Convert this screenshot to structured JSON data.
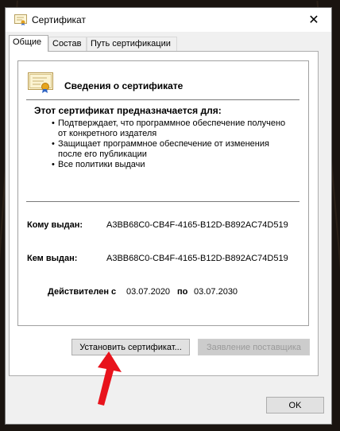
{
  "window": {
    "title": "Сертификат",
    "close_symbol": "✕"
  },
  "tabs": [
    {
      "label": "Общие"
    },
    {
      "label": "Состав"
    },
    {
      "label": "Путь сертификации"
    }
  ],
  "certificate": {
    "heading": "Сведения о сертификате",
    "purpose_title": "Этот сертификат предназначается для:",
    "purposes": [
      "Подтверждает, что программное обеспечение получено от конкретного издателя",
      "Защищает программное обеспечение от  изменения после его публикации",
      "Все политики выдачи"
    ],
    "issued_to_label": "Кому выдан:",
    "issued_to_value": "A3BB68C0-CB4F-4165-B12D-B892AC74D519",
    "issued_by_label": "Кем выдан:",
    "issued_by_value": "A3BB68C0-CB4F-4165-B12D-B892AC74D519",
    "valid_from_label": "Действителен с",
    "valid_from": "03.07.2020",
    "valid_to_label": "по",
    "valid_to": "03.07.2030"
  },
  "buttons": {
    "install": "Установить сертификат...",
    "issuer_statement": "Заявление поставщика",
    "ok": "OK"
  },
  "icons": {
    "title": "certificate-icon",
    "cert": "certificate-icon",
    "arrow": "red-arrow-icon"
  },
  "colors": {
    "arrow": "#e8131c",
    "background": "#1a1410"
  }
}
